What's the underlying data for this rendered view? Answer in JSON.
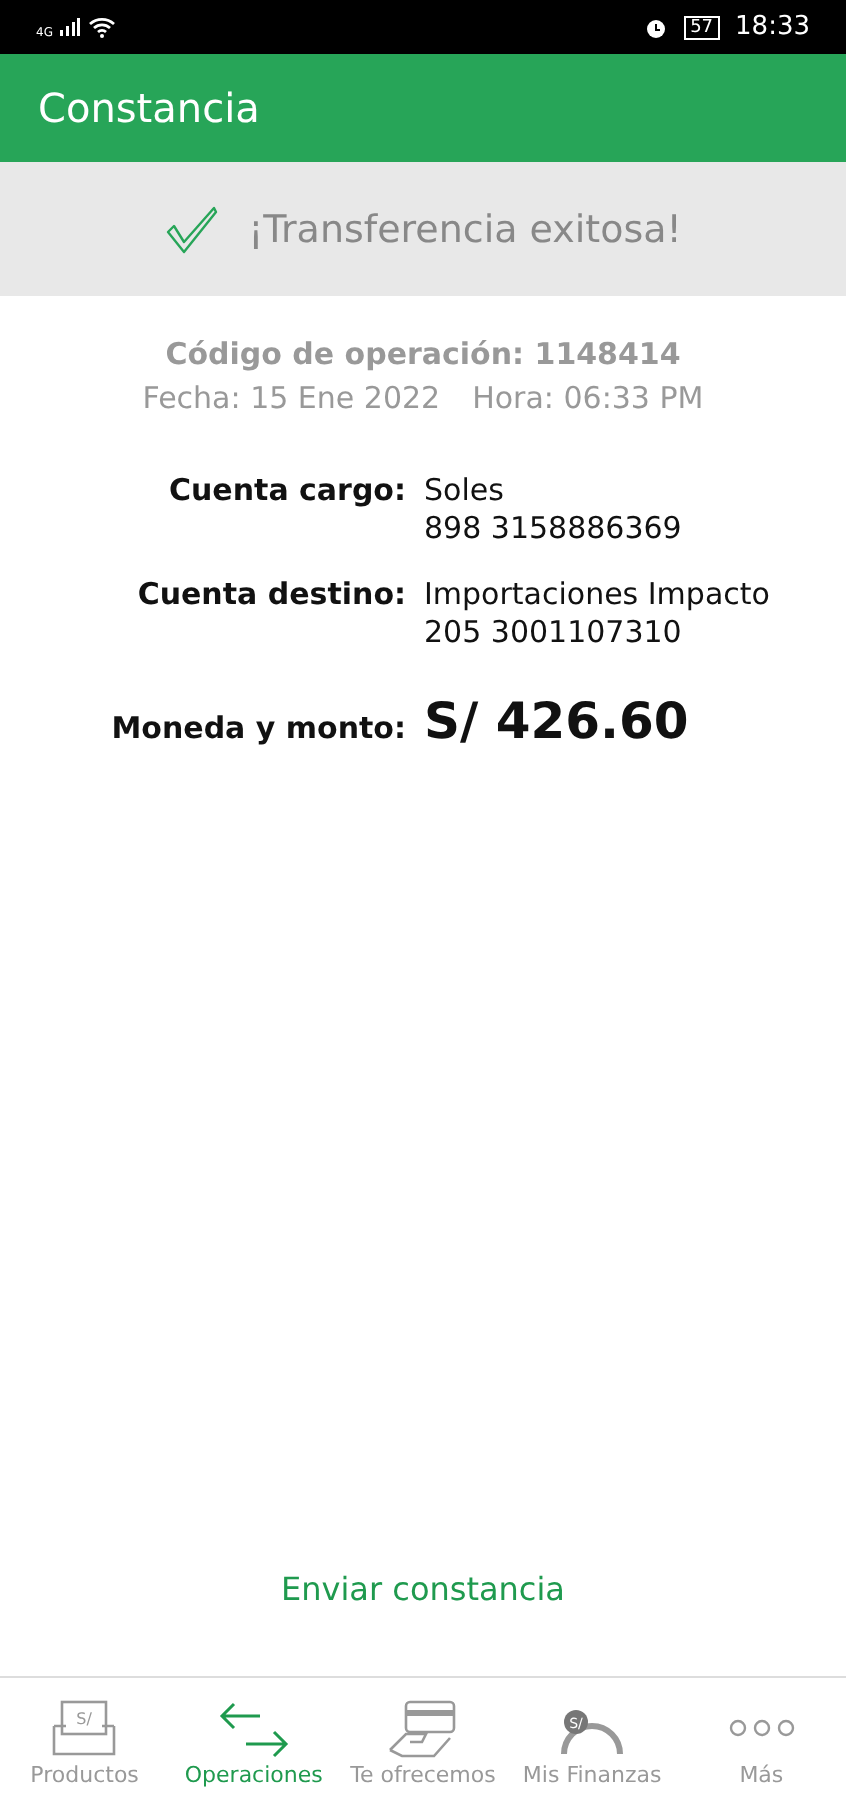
{
  "status_bar": {
    "network": "4G",
    "battery": "57",
    "time": "18:33"
  },
  "header": {
    "title": "Constancia"
  },
  "banner": {
    "message": "¡Transferencia exitosa!"
  },
  "operation": {
    "code": "Código de operación: 1148414",
    "date": "Fecha: 15 Ene 2022",
    "time": "Hora: 06:33 PM"
  },
  "details": [
    {
      "label": "Cuenta cargo:",
      "lines": [
        "Soles",
        "898 3158886369"
      ],
      "kind": "text"
    },
    {
      "label": "Cuenta destino:",
      "lines": [
        "Importaciones Impacto",
        "205 3001107310"
      ],
      "kind": "text"
    },
    {
      "label": "Moneda y monto:",
      "lines": [
        "S/ 426.60"
      ],
      "kind": "amount"
    }
  ],
  "action": "Enviar constancia",
  "tabs": [
    {
      "label": "Productos",
      "kind": "products",
      "icon_text": "S/",
      "selected": false
    },
    {
      "label": "Operaciones",
      "kind": "operations",
      "selected": true
    },
    {
      "label": "Te ofrecemos",
      "kind": "offers",
      "selected": false
    },
    {
      "label": "Mis Finanzas",
      "kind": "finance",
      "icon_text": "S/",
      "selected": false
    },
    {
      "label": "Más",
      "kind": "more",
      "selected": false
    }
  ]
}
